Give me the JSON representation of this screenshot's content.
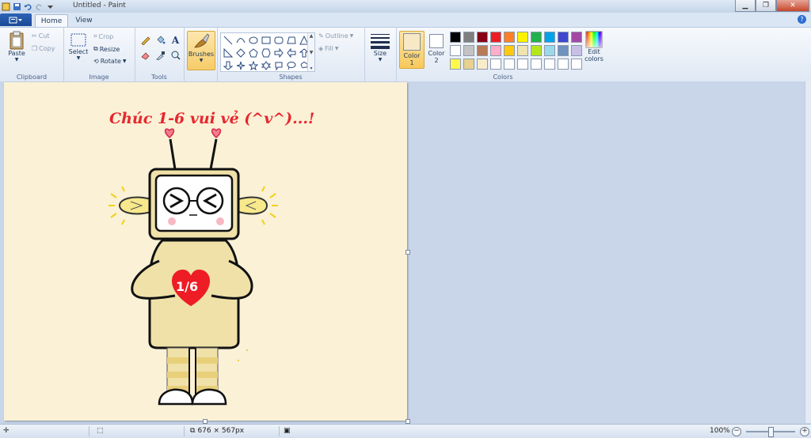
{
  "window": {
    "title": "Untitled - Paint"
  },
  "tabs": {
    "home": "Home",
    "view": "View"
  },
  "clipboard": {
    "paste": "Paste",
    "cut": "Cut",
    "copy": "Copy",
    "group": "Clipboard"
  },
  "image": {
    "select": "Select",
    "crop": "Crop",
    "resize": "Resize",
    "rotate": "Rotate",
    "group": "Image"
  },
  "tools": {
    "group": "Tools"
  },
  "brushes": {
    "label": "Brushes"
  },
  "shapes": {
    "outline": "Outline",
    "fill": "Fill",
    "group": "Shapes"
  },
  "size": {
    "label": "Size"
  },
  "colors": {
    "color1_label": "Color",
    "color1_num": "1",
    "color2_label": "Color",
    "color2_num": "2",
    "edit": "Edit",
    "edit2": "colors",
    "group": "Colors",
    "color1": "#f8e9c6",
    "color2": "#ffffff",
    "row1": [
      "#000000",
      "#7f7f7f",
      "#880015",
      "#ed1c24",
      "#ff7f27",
      "#fff200",
      "#22b14c",
      "#00a2e8",
      "#3f48cc",
      "#a349a4"
    ],
    "row2": [
      "#ffffff",
      "#c3c3c3",
      "#b97a57",
      "#ffaec9",
      "#ffc90e",
      "#efe4b0",
      "#b5e61d",
      "#99d9ea",
      "#7092be",
      "#c8bfe7"
    ],
    "row3": [
      "#fff94e",
      "#e8d18f",
      "#f8ecca",
      "#ffffff",
      "#ffffff",
      "#ffffff",
      "#ffffff",
      "#ffffff",
      "#ffffff",
      "#ffffff"
    ]
  },
  "drawing": {
    "greeting": "Chúc 1-6 vui vẻ (^v^)...!",
    "heart_text": "1/6"
  },
  "status": {
    "dimensions": "676 × 567px",
    "zoom": "100%"
  }
}
